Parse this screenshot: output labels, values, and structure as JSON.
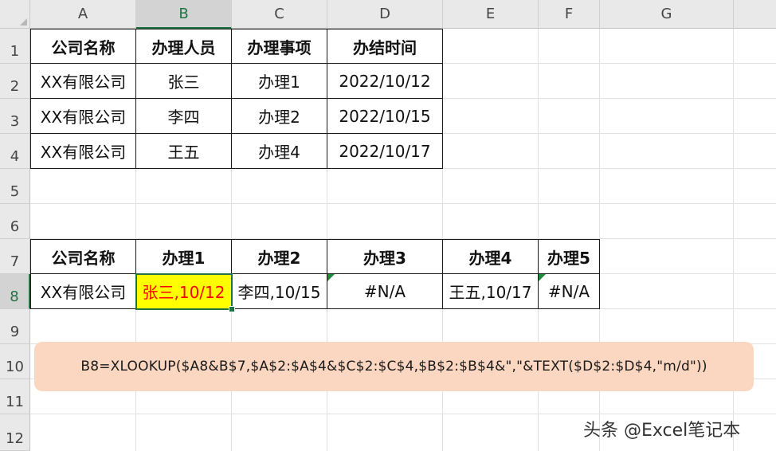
{
  "columns": [
    "A",
    "B",
    "C",
    "D",
    "E",
    "F",
    "G"
  ],
  "rows": [
    "1",
    "2",
    "3",
    "4",
    "5",
    "6",
    "7",
    "8",
    "9",
    "10",
    "11",
    "12"
  ],
  "table1": {
    "headers": [
      "公司名称",
      "办理人员",
      "办理事项",
      "办结时间"
    ],
    "rows": [
      [
        "XX有限公司",
        "张三",
        "办理1",
        "2022/10/12"
      ],
      [
        "XX有限公司",
        "李四",
        "办理2",
        "2022/10/15"
      ],
      [
        "XX有限公司",
        "王五",
        "办理4",
        "2022/10/17"
      ]
    ]
  },
  "table2": {
    "headers": [
      "公司名称",
      "办理1",
      "办理2",
      "办理3",
      "办理4",
      "办理5"
    ],
    "row": [
      "XX有限公司",
      "张三,10/12",
      "李四,10/15",
      "#N/A",
      "王五,10/17",
      "#N/A"
    ]
  },
  "selected_cell": "B8",
  "formula_note": "B8=XLOOKUP($A8&B$7,$A$2:$A$4&$C$2:$C$4,$B$2:$B$4&\",\"&TEXT($D$2:$D$4,\"m/d\"))",
  "watermark": "头条 @Excel笔记本",
  "colors": {
    "highlight_fill": "#ffff00",
    "highlight_text": "#ff0000",
    "note_fill": "#fbd6c0",
    "selection": "#217346",
    "error_indicator": "#1f8a3a"
  }
}
